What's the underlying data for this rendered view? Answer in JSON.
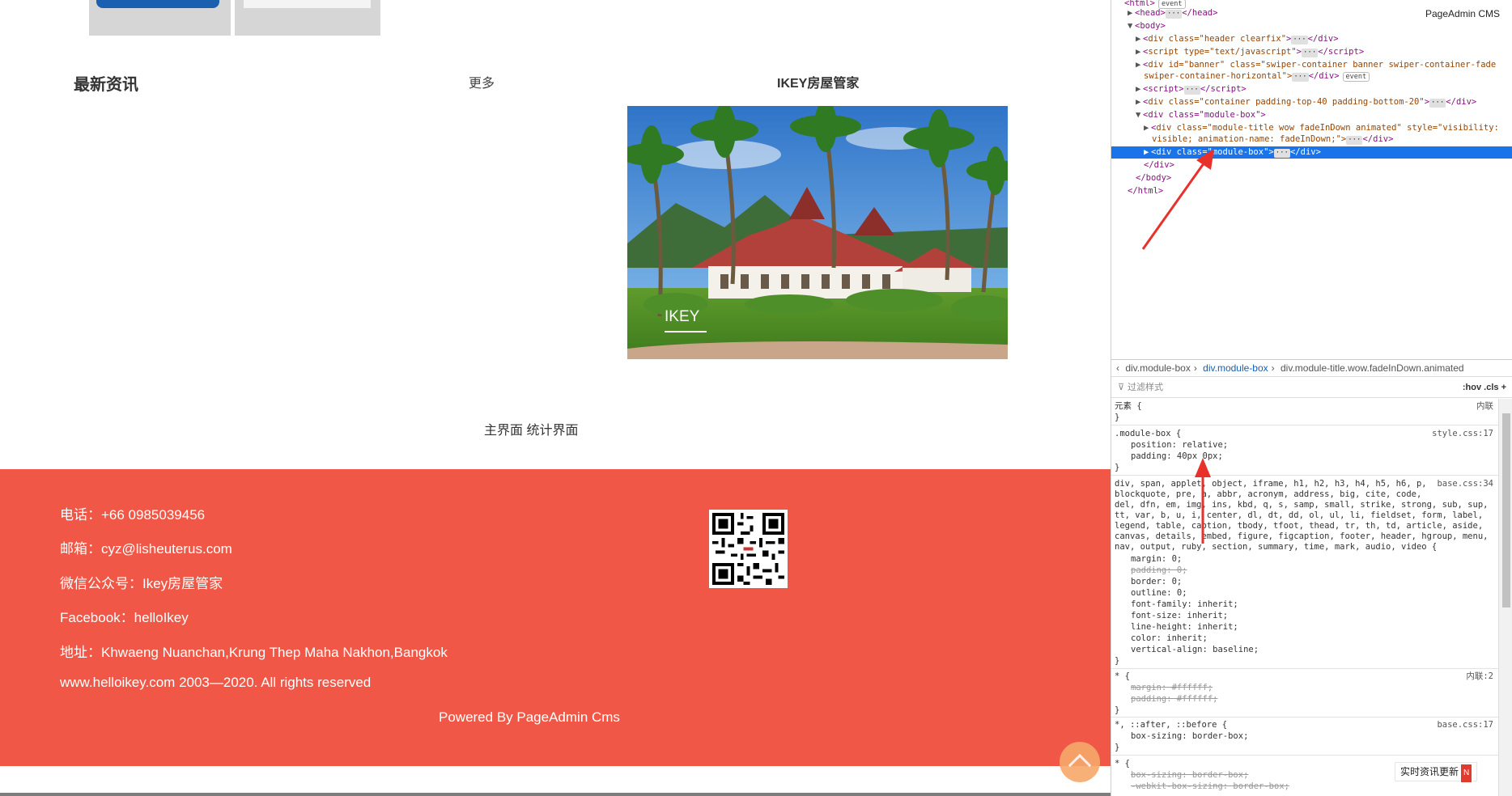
{
  "site": {
    "news_heading": "最新资讯",
    "more_link": "更多",
    "ikey_heading": "IKEY房屋管家",
    "photo_caption": "IKEY",
    "switch_links": [
      "主界面",
      "统计界面"
    ],
    "footer": {
      "phone": "电话：+66 0985039456",
      "email": "邮箱：cyz@lisheuterus.com",
      "wechat": "微信公众号：Ikey房屋管家",
      "facebook": "Facebook：helloIkey",
      "address": "地址：Khwaeng Nuanchan,Krung Thep Maha Nakhon,Bangkok",
      "copyright": "www.helloikey.com 2003—2020. All rights reserved",
      "powered": "Powered By PageAdmin Cms"
    },
    "colors": {
      "footer_bg": "#f05746",
      "brand_blue": "#1a5fb0",
      "scroll_top": "#f6a86a"
    },
    "icons": [
      "qr-code-icon",
      "chevron-up-icon"
    ]
  },
  "devtools": {
    "cms_label": "PageAdmin CMS",
    "dom": {
      "head": "<head>",
      "head_close": "</head>",
      "body": "<body>",
      "header": "div class=\"header clearfix\"",
      "script1": "script type=\"text/javascript\"",
      "banner1": "div id=\"banner\" class=\"swiper-container banner swiper-container-fade",
      "banner2": "swiper-container-horizontal\">",
      "script2": "<script>",
      "container": "div class=\"container padding-top-40 padding-bottom-20\"",
      "module_box": "<div class=\"module-box\">",
      "module_title1": "div class=\"module-title wow fadeInDown animated\" style=\"visibility:",
      "module_title2": "visible; animation-name: fadeInDown;\">",
      "selected": "<div class=\"module-box\">",
      "div_close": "</div>",
      "body_close": "</body>",
      "html_close": "</html>",
      "event_badge": "event"
    },
    "breadcrumbs": [
      "div.module-box",
      "div.module-box",
      "div.module-title.wow.fadeInDown.animated"
    ],
    "filter_placeholder": "过滤样式",
    "filter_tools": ":hov .cls +",
    "styles": {
      "element_label": "元素 {",
      "inline_src": "内联",
      "rule1_selector": ".module-box {",
      "rule1_src": "style.css:17",
      "rule1_props": [
        "position: relative;",
        "padding: 40px 0px;"
      ],
      "rule2_selector_lines": [
        "div, span, applet, object, iframe, h1, h2, h3, h4, h5, h6, p,",
        "blockquote, pre, a, abbr, acronym, address, big, cite, code,",
        "del, dfn, em, img, ins, kbd, q, s, samp, small, strike, strong, sub, sup,",
        "tt, var, b, u, i, center, dl, dt, dd, ol, ul, li, fieldset, form, label,",
        "legend, table, caption, tbody, tfoot, thead, tr, th, td, article, aside,",
        "canvas, details, embed, figure, figcaption, footer, header, hgroup, menu,",
        "nav, output, ruby, section, summary, time, mark, audio, video {"
      ],
      "rule2_src": "base.css:34",
      "rule2_props": [
        "margin: 0;",
        "padding: 0;",
        "border: 0;",
        "outline: 0;",
        "font-family: inherit;",
        "font-size: inherit;",
        "line-height: inherit;",
        "color: inherit;",
        "vertical-align: baseline;"
      ],
      "rule3_selector": "* {",
      "rule3_src": "内联:2",
      "rule3_props": [
        "margin: #ffffff;",
        "padding: #ffffff;"
      ],
      "rule4_selector": "*, ::after, ::before {",
      "rule4_src": "base.css:17",
      "rule4_props": [
        "box-sizing: border-box;"
      ],
      "rule5_selector": "* {",
      "rule5_props": [
        "box-sizing: border-box;",
        "-webkit-box-sizing: border-box;"
      ],
      "close_brace": "}"
    },
    "toast": "实时资讯更新",
    "toast_badge": "N"
  }
}
